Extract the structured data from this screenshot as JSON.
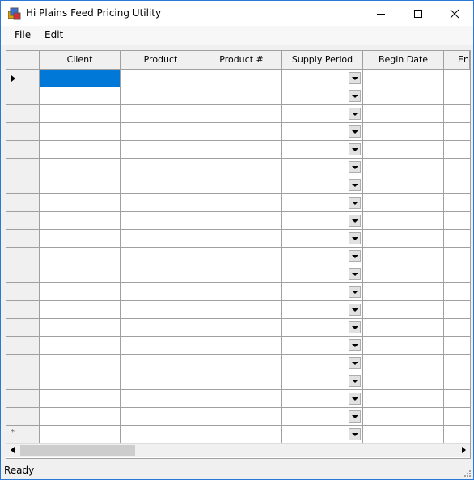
{
  "window": {
    "title": "Hi Plains Feed Pricing Utility"
  },
  "menu": {
    "file": "File",
    "edit": "Edit"
  },
  "grid": {
    "columns": [
      "Client",
      "Product",
      "Product #",
      "Supply Period",
      "Begin Date",
      "End"
    ],
    "row_count": 21,
    "selected_row": 0,
    "selected_column": "Client",
    "new_row_marker": "*"
  },
  "status": {
    "text": "Ready"
  },
  "colors": {
    "selection": "#0078d7",
    "border": "#a0a0a0",
    "header_bg": "#f0f0f0"
  },
  "icons": [
    "app-icon",
    "minimize-icon",
    "maximize-icon",
    "close-icon",
    "row-pointer-icon",
    "dropdown-arrow-icon",
    "scroll-left-icon",
    "scroll-right-icon",
    "size-grip-icon"
  ]
}
